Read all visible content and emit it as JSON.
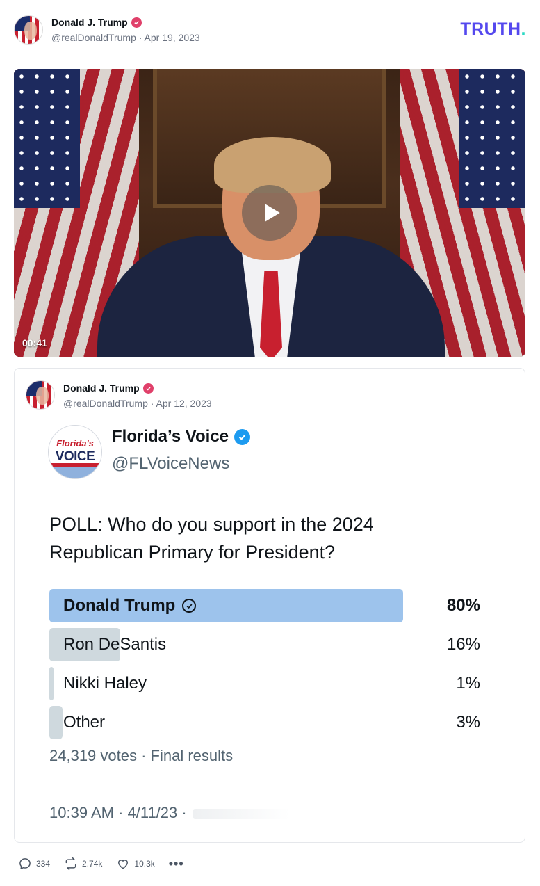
{
  "post": {
    "author_name": "Donald J. Trump",
    "author_meta": "@realDonaldTrump · Apr 19, 2023",
    "brand_logo": "TRUTH",
    "brand_logo_dot": ".",
    "video": {
      "duration": "00:41",
      "play_icon": "play-icon"
    },
    "actions": {
      "replies": "334",
      "retruths": "2.74k",
      "likes": "10.3k",
      "more": "•••"
    }
  },
  "quoted_post": {
    "author_name": "Donald J. Trump",
    "author_meta": "@realDonaldTrump · Apr 12, 2023",
    "embedded_tweet": {
      "account_name": "Florida’s Voice",
      "account_handle": "@FLVoiceNews",
      "logo_text_top": "Florida's",
      "logo_text_bottom": "VOICE",
      "question": "POLL: Who do you support in the 2024 Republican Primary for President?",
      "options": [
        {
          "label": "Donald Trump",
          "percent_text": "80%",
          "share": 0.8,
          "winner": true
        },
        {
          "label": "Ron DeSantis",
          "percent_text": "16%",
          "share": 0.16,
          "winner": false
        },
        {
          "label": "Nikki Haley",
          "percent_text": "1%",
          "share": 0.01,
          "winner": false
        },
        {
          "label": "Other",
          "percent_text": "3%",
          "share": 0.03,
          "winner": false
        }
      ],
      "votes_summary": "24,319 votes · Final results",
      "timestamp": "10:39 AM · 4/11/23 ·"
    }
  },
  "colors": {
    "brand": "#5448ee",
    "brand_dot": "#2bd9c4",
    "verified_truth": "#e0406a",
    "verified_twitter": "#1d9bf0",
    "poll_winner": "#9dc3ec",
    "poll_other": "#cfd9de"
  }
}
